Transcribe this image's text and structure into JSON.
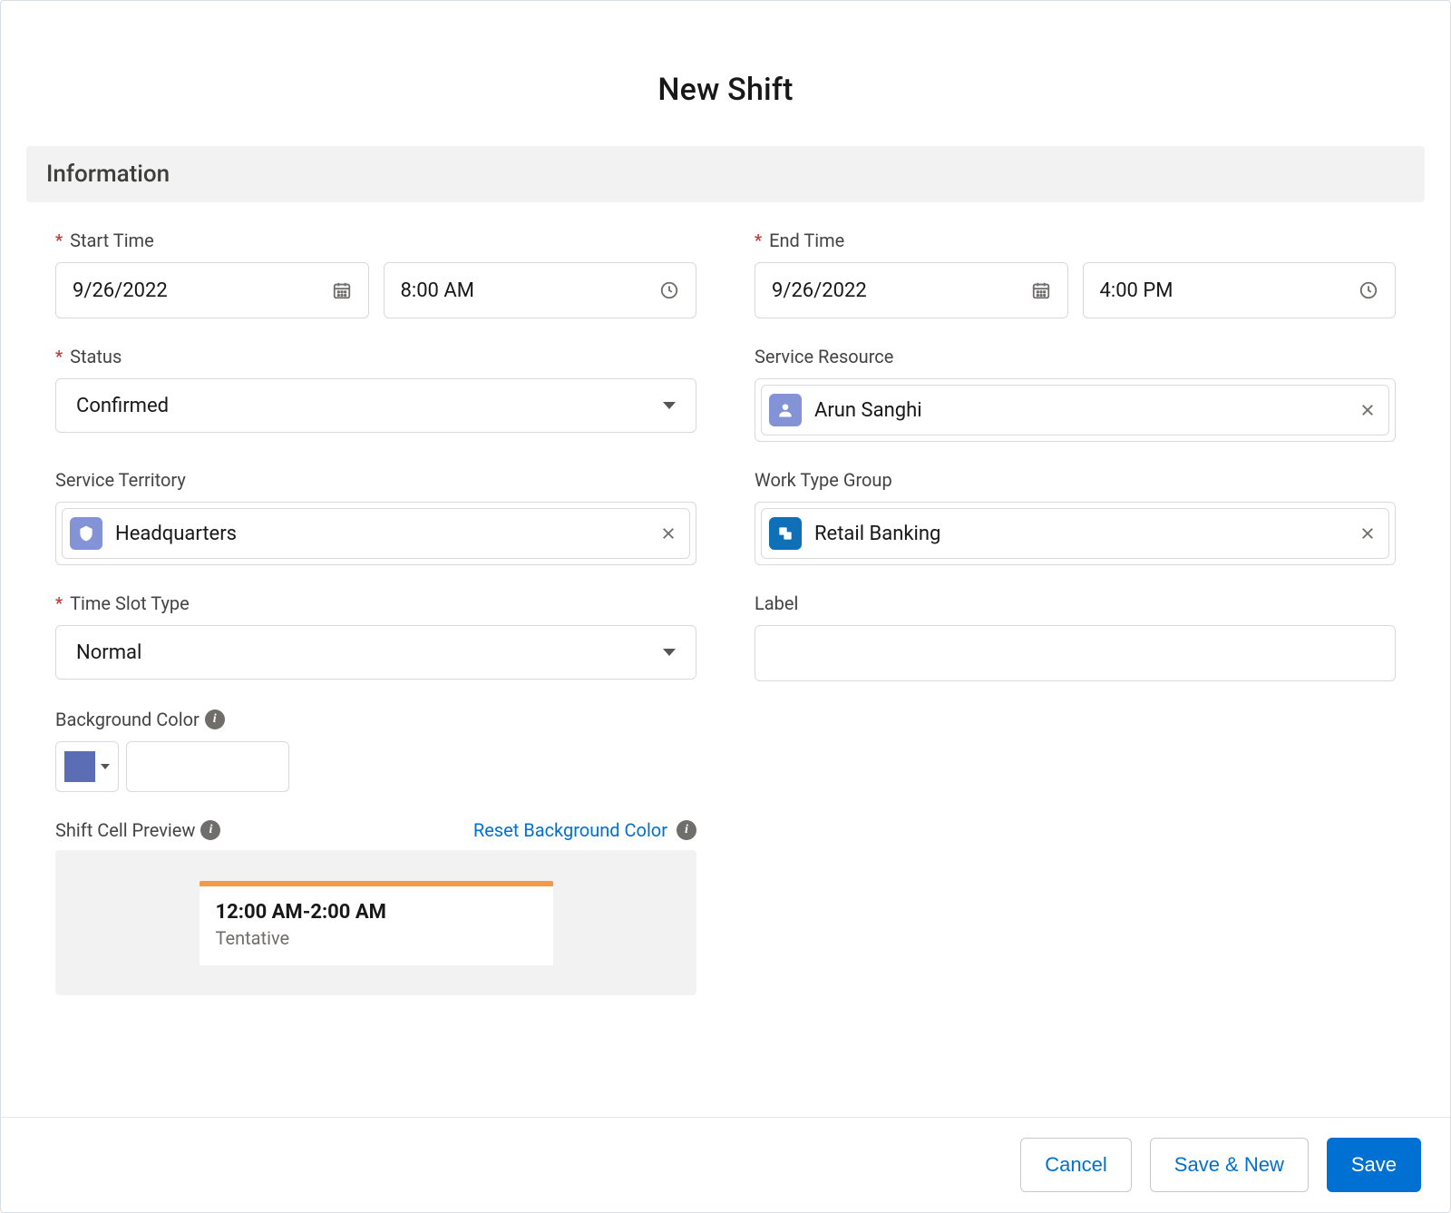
{
  "modal": {
    "title": "New Shift",
    "section": "Information"
  },
  "fields": {
    "start_time": {
      "label": "Start Time",
      "required": true,
      "date": "9/26/2022",
      "time": "8:00 AM"
    },
    "end_time": {
      "label": "End Time",
      "required": true,
      "date": "9/26/2022",
      "time": "4:00 PM"
    },
    "status": {
      "label": "Status",
      "required": true,
      "value": "Confirmed"
    },
    "service_resource": {
      "label": "Service Resource",
      "value": "Arun Sanghi",
      "icon_name": "resource",
      "icon_bg": "#8493d6"
    },
    "service_territory": {
      "label": "Service Territory",
      "value": "Headquarters",
      "icon_name": "territory",
      "icon_bg": "#8493d6"
    },
    "work_type_group": {
      "label": "Work Type Group",
      "value": "Retail Banking",
      "icon_name": "worktype",
      "icon_bg": "#0f70b7"
    },
    "time_slot_type": {
      "label": "Time Slot Type",
      "required": true,
      "value": "Normal"
    },
    "label": {
      "label": "Label",
      "value": ""
    },
    "background_color": {
      "label": "Background Color",
      "swatch": "#5b6db5",
      "hex_value": ""
    },
    "shift_cell_preview": {
      "label": "Shift Cell Preview",
      "reset_text": "Reset Background Color",
      "time_range": "12:00 AM-2:00 AM",
      "status": "Tentative",
      "accent": "#f2994a"
    }
  },
  "footer": {
    "cancel": "Cancel",
    "save_new": "Save & New",
    "save": "Save"
  }
}
